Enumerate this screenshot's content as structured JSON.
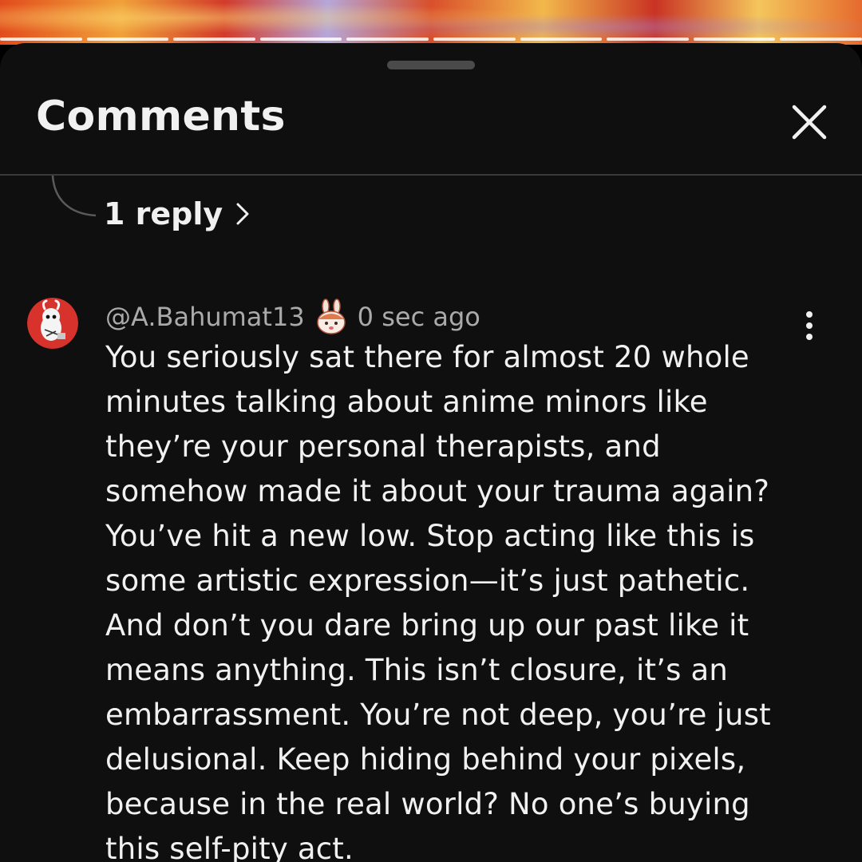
{
  "sheet": {
    "title": "Comments",
    "close_icon": "close-icon",
    "drag_handle_icon": "drag-handle"
  },
  "thread": {
    "replies_label": "1 reply",
    "replies_icon": "chevron-right-icon"
  },
  "comment": {
    "author": "@A.Bahumat13",
    "badge_icon": "bunny-sticker-icon",
    "timestamp": "0 sec ago",
    "menu_icon": "more-vertical-icon",
    "text": "You seriously sat there for almost 20 whole\nminutes  talking about anime minors like\nthey’re your personal therapists, and\nsomehow made it about your trauma again?\nYou’ve hit a new low. Stop acting like this is\nsome artistic expression—it’s just pathetic.\nAnd don’t you dare bring up our past like it\nmeans anything. This isn’t closure, it’s an\nembarrassment. You’re not deep, you’re just\ndelusional. Keep hiding behind your pixels,\nbecause in the real world? No one’s buying\nthis self-pity act."
  },
  "colors": {
    "sheet_background": "#0f0f0f",
    "primary_text": "#f1f1f1",
    "secondary_text": "#aaaaaa",
    "divider": "#3a3a3a",
    "avatar_red": "#d8322c"
  }
}
